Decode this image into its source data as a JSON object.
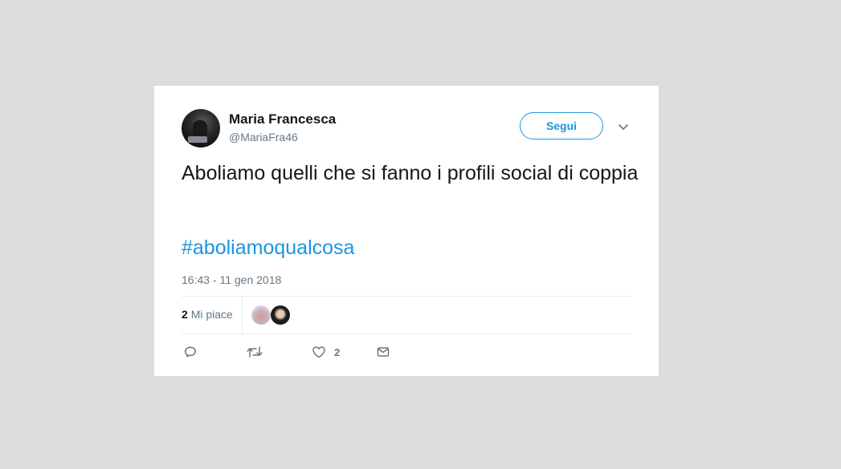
{
  "user": {
    "display_name": "Maria Francesca",
    "handle": "@MariaFra46"
  },
  "follow_button": {
    "label": "Segui"
  },
  "tweet": {
    "text": "Aboliamo quelli che si fanno i profili social di coppia",
    "hashtag": "#aboliamoqualcosa",
    "timestamp": "16:43 - 11 gen 2018"
  },
  "likes": {
    "count": "2",
    "label": "Mi piace"
  },
  "actions": {
    "reply_icon": "reply-icon",
    "retweet_icon": "retweet-icon",
    "like_icon": "heart-icon",
    "like_count": "2",
    "message_icon": "envelope-icon"
  },
  "colors": {
    "accent": "#1b95e0",
    "text": "#14171a",
    "muted": "#657786",
    "background": "#dcdcdc"
  }
}
